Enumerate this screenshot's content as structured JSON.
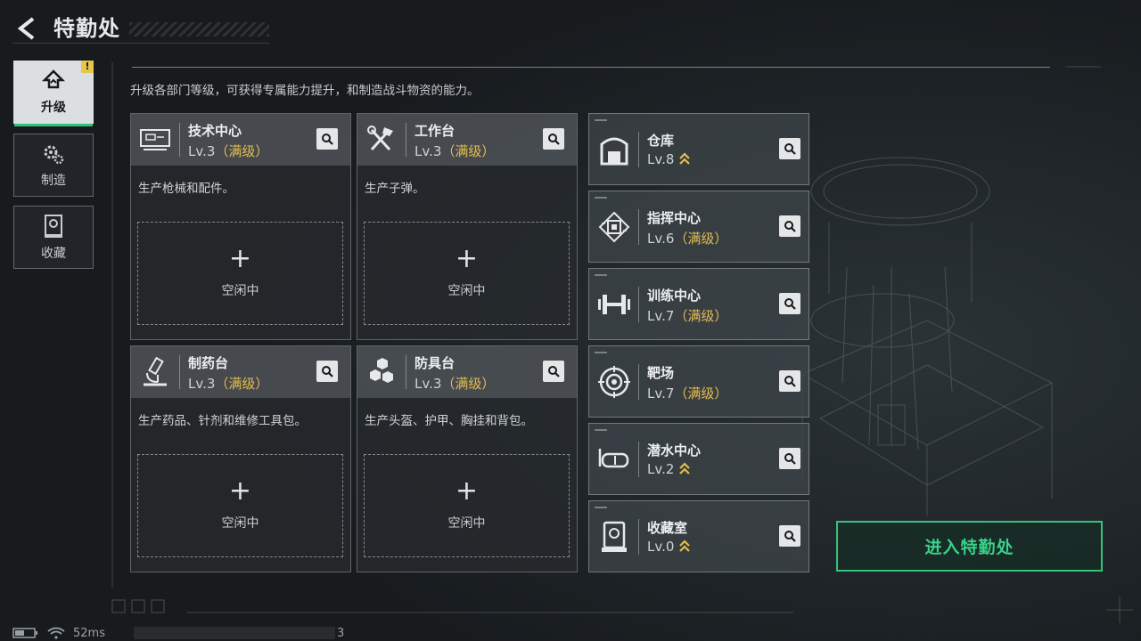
{
  "header": {
    "title": "特勤处"
  },
  "nav": {
    "items": [
      {
        "label": "升级",
        "active": true,
        "icon": "upgrade-icon",
        "badge": "!"
      },
      {
        "label": "制造",
        "active": false,
        "icon": "gear-icon"
      },
      {
        "label": "收藏",
        "active": false,
        "icon": "collection-icon"
      }
    ]
  },
  "description": "升级各部门等级，可获得专属能力提升，和制造战斗物资的能力。",
  "production_cards": [
    {
      "name": "技术中心",
      "level": "Lv.3",
      "status": "（满级）",
      "desc": "生产枪械和配件。",
      "slot_label": "空闲中",
      "icon": "tech-center-icon"
    },
    {
      "name": "工作台",
      "level": "Lv.3",
      "status": "（满级）",
      "desc": "生产子弹。",
      "slot_label": "空闲中",
      "icon": "tools-icon"
    },
    {
      "name": "制药台",
      "level": "Lv.3",
      "status": "（满级）",
      "desc": "生产药品、针剂和维修工具包。",
      "slot_label": "空闲中",
      "icon": "microscope-icon"
    },
    {
      "name": "防具台",
      "level": "Lv.3",
      "status": "（满级）",
      "desc": "生产头盔、护甲、胸挂和背包。",
      "slot_label": "空闲中",
      "icon": "armor-cubes-icon"
    }
  ],
  "facility_cards": [
    {
      "name": "仓库",
      "level": "Lv.8",
      "status": "",
      "upgradable": true,
      "icon": "warehouse-icon"
    },
    {
      "name": "指挥中心",
      "level": "Lv.6",
      "status": "（满级）",
      "upgradable": false,
      "icon": "chip-icon"
    },
    {
      "name": "训练中心",
      "level": "Lv.7",
      "status": "（满级）",
      "upgradable": false,
      "icon": "dumbbell-icon"
    },
    {
      "name": "靶场",
      "level": "Lv.7",
      "status": "（满级）",
      "upgradable": false,
      "icon": "target-icon"
    },
    {
      "name": "潜水中心",
      "level": "Lv.2",
      "status": "",
      "upgradable": true,
      "icon": "diving-mask-icon"
    },
    {
      "name": "收藏室",
      "level": "Lv.0",
      "status": "",
      "upgradable": true,
      "icon": "display-case-icon"
    }
  ],
  "enter_button": {
    "label": "进入特勤处"
  },
  "status_bar": {
    "ping": "52ms",
    "trailing": "3"
  },
  "colors": {
    "accent": "#34c47b",
    "maxed": "#e3bc4e",
    "badge": "#e9c54c"
  }
}
